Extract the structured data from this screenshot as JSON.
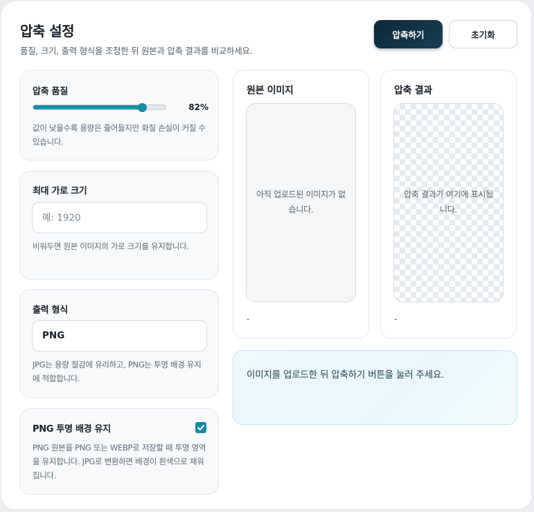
{
  "header": {
    "title": "압축 설정",
    "subtitle": "품질, 크기, 출력 형식을 조정한 뒤 원본과 압축 결과를 비교하세요.",
    "compress_button": "압축하기",
    "reset_button": "초기화"
  },
  "quality": {
    "label": "압축 품질",
    "value": 82,
    "value_text": "82%",
    "helper": "값이 낮을수록 용량은 줄어들지만 화질 손실이 커질 수 있습니다."
  },
  "max_width": {
    "label": "최대 가로 크기",
    "placeholder": "예: 1920",
    "value": "",
    "helper": "비워두면 원본 이미지의 가로 크기를 유지합니다."
  },
  "format": {
    "label": "출력 형식",
    "selected": "PNG",
    "helper": "JPG는 용량 절감에 유리하고, PNG는 투명 배경 유지에 적합합니다."
  },
  "transparency": {
    "label": "PNG 투명 배경 유지",
    "checked": true,
    "helper": "PNG 원본을 PNG 또는 WEBP로 저장할 때 투명 영역을 유지합니다. JPG로 변환하면 배경이 흰색으로 채워집니다."
  },
  "original": {
    "title": "원본 이미지",
    "placeholder": "아직 업로드된 이미지가 없습니다.",
    "meta": "-"
  },
  "result": {
    "title": "압축 결과",
    "placeholder": "압축 결과가 여기에 표시됩니다.",
    "meta": "-"
  },
  "info": {
    "message": "이미지를 업로드한 뒤 압축하기 버튼을 눌러 주세요."
  },
  "colors": {
    "accent": "#158aa1",
    "primary_button": "#0e2838",
    "info_border": "#bfe6ef"
  }
}
